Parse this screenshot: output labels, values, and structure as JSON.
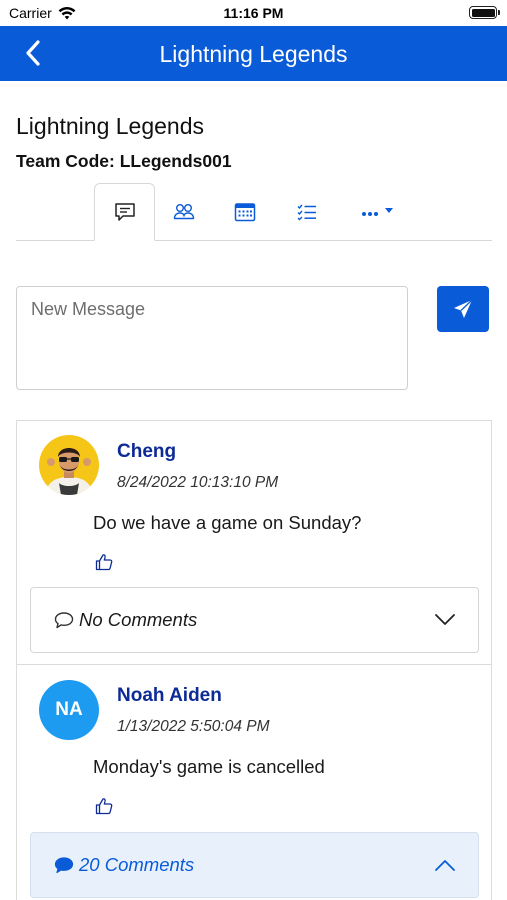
{
  "status_bar": {
    "carrier": "Carrier",
    "time": "11:16 PM"
  },
  "header": {
    "title": "Lightning Legends"
  },
  "team": {
    "name": "Lightning Legends",
    "code": "Team Code: LLegends001"
  },
  "tabs": [
    {
      "icon": "chat-icon",
      "active": true
    },
    {
      "icon": "members-icon",
      "active": false
    },
    {
      "icon": "calendar-icon",
      "active": false
    },
    {
      "icon": "checklist-icon",
      "active": false
    },
    {
      "icon": "more-icon",
      "active": false
    }
  ],
  "composer": {
    "placeholder": "New Message"
  },
  "posts": [
    {
      "author": "Cheng",
      "timestamp": "8/24/2022 10:13:10 PM",
      "message": "Do we have a game on Sunday?",
      "comments_label": "No Comments"
    },
    {
      "author": "Noah Aiden",
      "initials": "NA",
      "timestamp": "1/13/2022 5:50:04 PM",
      "message": "Monday's game is cancelled",
      "comments_label": "20 Comments"
    }
  ],
  "colors": {
    "brand": "#0a5bd8",
    "author": "#0d2b95",
    "avatar_initials_bg": "#1d9bf0",
    "comments_open_bg": "#e8f0fc"
  }
}
